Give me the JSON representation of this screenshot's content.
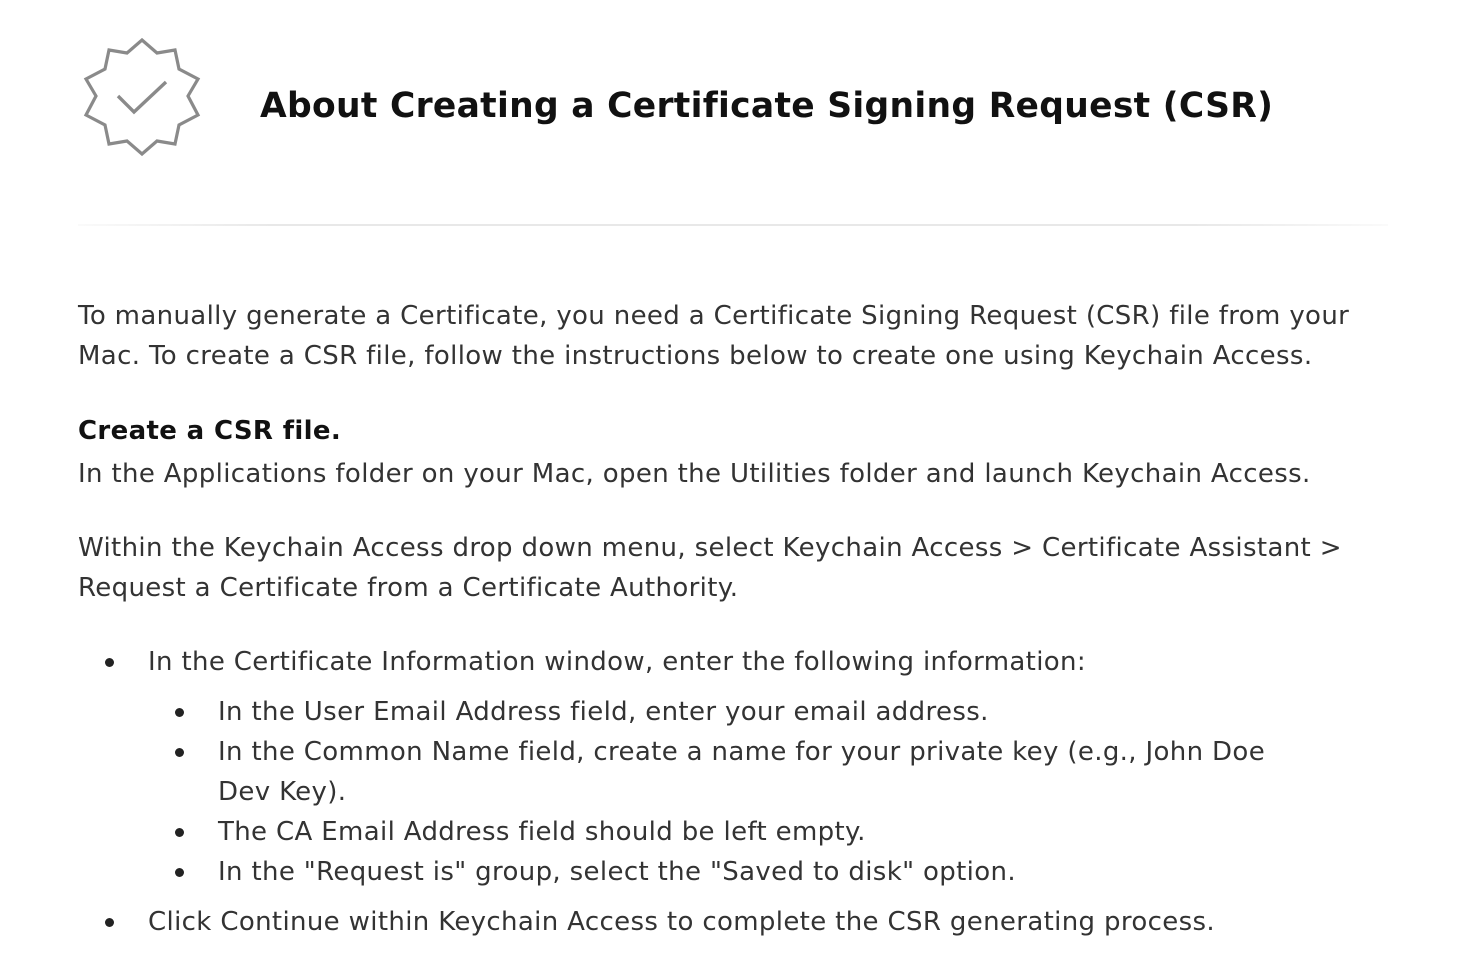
{
  "header": {
    "icon": "certificate-badge-check-icon",
    "title": "About Creating a Certificate Signing Request (CSR)"
  },
  "content": {
    "intro": "To manually generate a Certificate, you need a Certificate Signing Request (CSR) file from your Mac. To create a CSR file, follow the instructions below to create one using Keychain Access.",
    "section_heading": "Create a CSR file.",
    "step1": "In the Applications folder on your Mac, open the Utilities folder and launch Keychain Access.",
    "step2": "Within the Keychain Access drop down menu, select Keychain Access > Certificate Assistant > Request a Certificate from a Certificate Authority.",
    "bullets": [
      {
        "text": "In the Certificate Information window, enter the following information:",
        "sub": [
          "In the User Email Address field, enter your email address.",
          "In the Common Name field, create a name for your private key (e.g., John Doe Dev Key).",
          "The CA Email Address field should be left empty.",
          "In the \"Request is\" group, select the \"Saved to disk\" option."
        ]
      },
      {
        "text": "Click Continue within Keychain Access to complete the CSR generating process."
      }
    ]
  },
  "colors": {
    "title": "#111111",
    "body_text": "#333333",
    "icon_stroke": "#8a8a8a",
    "divider": "#e8e8e8"
  }
}
